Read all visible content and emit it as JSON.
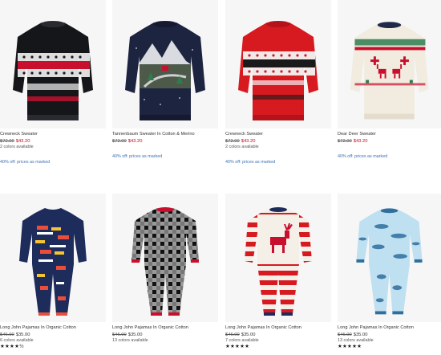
{
  "products": [
    {
      "title": "Crewneck Sweater",
      "old_price": "$72.00",
      "new_price": "$43.20",
      "colors": "2 colors available",
      "promo": "40% off: prices as marked",
      "stars": "",
      "image": "black-fairisle-sweater"
    },
    {
      "title": "Tannenbaum Sweater In Cotton & Merino",
      "old_price": "$72.00",
      "new_price": "$43.20",
      "colors": "",
      "promo": "40% off: prices as marked",
      "stars": "",
      "image": "navy-mountain-sweater"
    },
    {
      "title": "Crewneck Sweater",
      "old_price": "$72.00",
      "new_price": "$43.20",
      "colors": "2 colors available",
      "promo": "40% off: prices as marked",
      "stars": "",
      "image": "red-fairisle-sweater"
    },
    {
      "title": "Dear Deer Sweater",
      "old_price": "$72.00",
      "new_price": "$43.20",
      "colors": "",
      "promo": "40% off: prices as marked",
      "stars": "",
      "image": "cream-reindeer-sweater"
    },
    {
      "title": "Long John Pajamas In Organic Cotton",
      "old_price": "$46.00",
      "new_price": "$35.00",
      "colors": "6 colors available",
      "promo": "",
      "stars": "★★★★½",
      "image": "navy-bus-pajamas"
    },
    {
      "title": "Long John Pajamas In Organic Cotton",
      "old_price": "$46.00",
      "new_price": "$35.00",
      "colors": "13 colors available",
      "promo": "",
      "stars": "",
      "image": "buffalo-check-pajamas"
    },
    {
      "title": "Long John Pajamas In Organic Cotton",
      "old_price": "$46.00",
      "new_price": "$35.00",
      "colors": "7 colors available",
      "promo": "",
      "stars": "★★★★★",
      "image": "red-stripe-reindeer-pajamas"
    },
    {
      "title": "Long John Pajamas In Organic Cotton",
      "old_price": "$46.00",
      "new_price": "$35.00",
      "colors": "13 colors available",
      "promo": "",
      "stars": "★★★★★",
      "image": "blue-whale-pajamas"
    }
  ],
  "colors": {
    "sale_red": "#d0021b",
    "promo_blue": "#3c6fb4"
  }
}
